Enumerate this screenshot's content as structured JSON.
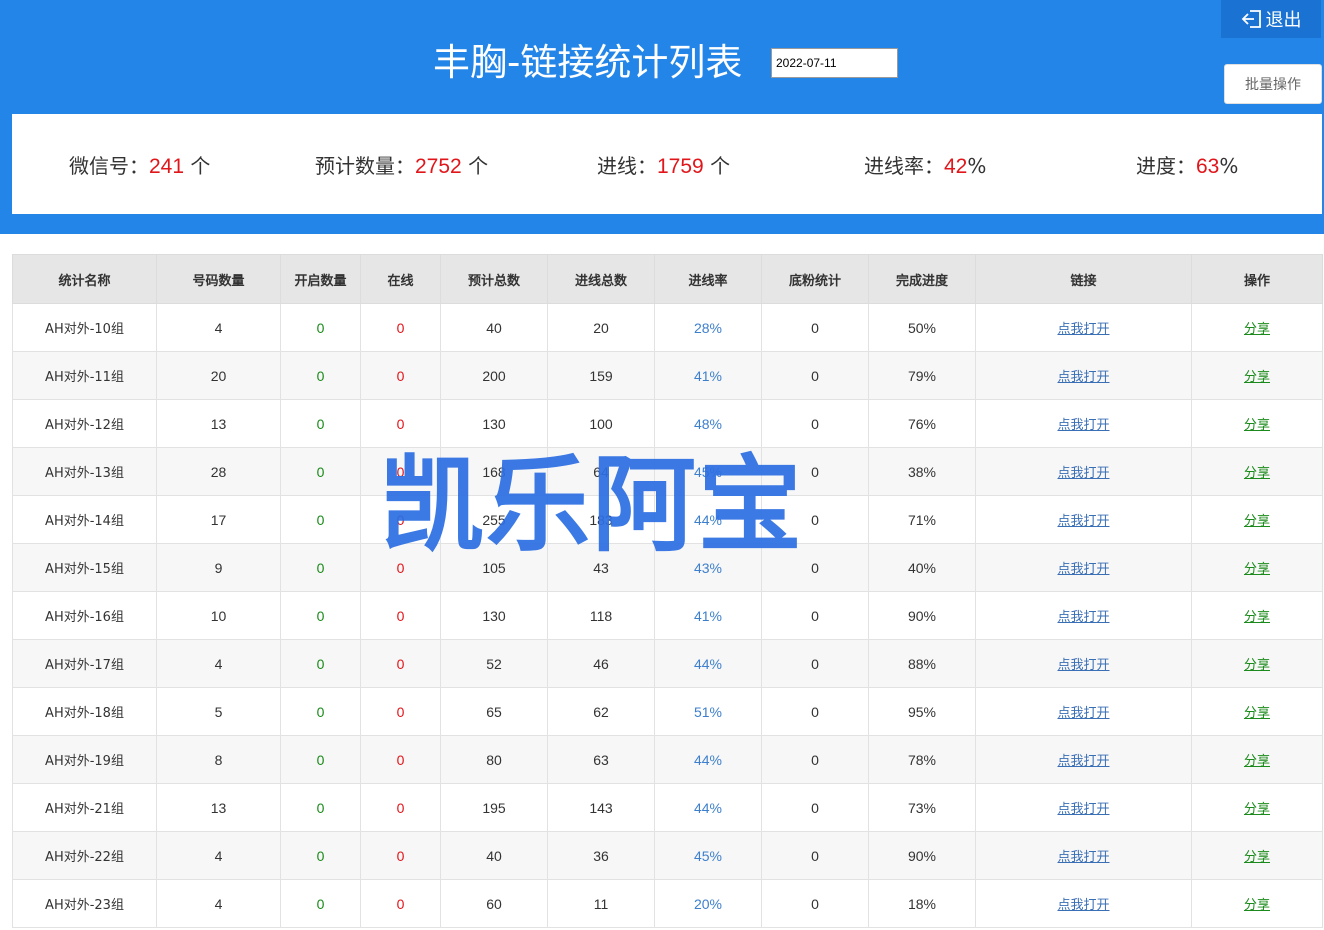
{
  "header": {
    "title": "丰胸-链接统计列表",
    "date_value": "2022-07-11",
    "logout_label": "退出",
    "batch_label": "批量操作"
  },
  "stats": {
    "wechat": {
      "label": "微信号：",
      "value": "241",
      "unit": " 个"
    },
    "expected": {
      "label": "预计数量：",
      "value": "2752",
      "unit": " 个"
    },
    "incoming": {
      "label": "进线：",
      "value": "1759",
      "unit": " 个"
    },
    "rate": {
      "label": "进线率：",
      "value": "42",
      "unit": "%"
    },
    "progress": {
      "label": "进度：",
      "value": "63",
      "unit": "%"
    }
  },
  "table": {
    "columns": [
      "统计名称",
      "号码数量",
      "开启数量",
      "在线",
      "预计总数",
      "进线总数",
      "进线率",
      "底粉统计",
      "完成进度",
      "链接",
      "操作"
    ],
    "link_label": "点我打开",
    "share_label": "分享",
    "rows": [
      {
        "name": "AH对外-10组",
        "numbers": "4",
        "enabled": "0",
        "online": "0",
        "expected": "40",
        "incoming": "20",
        "rate": "28%",
        "base": "0",
        "progress": "50%"
      },
      {
        "name": "AH对外-11组",
        "numbers": "20",
        "enabled": "0",
        "online": "0",
        "expected": "200",
        "incoming": "159",
        "rate": "41%",
        "base": "0",
        "progress": "79%"
      },
      {
        "name": "AH对外-12组",
        "numbers": "13",
        "enabled": "0",
        "online": "0",
        "expected": "130",
        "incoming": "100",
        "rate": "48%",
        "base": "0",
        "progress": "76%"
      },
      {
        "name": "AH对外-13组",
        "numbers": "28",
        "enabled": "0",
        "online": "0",
        "expected": "168",
        "incoming": "64",
        "rate": "45%",
        "base": "0",
        "progress": "38%"
      },
      {
        "name": "AH对外-14组",
        "numbers": "17",
        "enabled": "0",
        "online": "0",
        "expected": "255",
        "incoming": "183",
        "rate": "44%",
        "base": "0",
        "progress": "71%"
      },
      {
        "name": "AH对外-15组",
        "numbers": "9",
        "enabled": "0",
        "online": "0",
        "expected": "105",
        "incoming": "43",
        "rate": "43%",
        "base": "0",
        "progress": "40%"
      },
      {
        "name": "AH对外-16组",
        "numbers": "10",
        "enabled": "0",
        "online": "0",
        "expected": "130",
        "incoming": "118",
        "rate": "41%",
        "base": "0",
        "progress": "90%"
      },
      {
        "name": "AH对外-17组",
        "numbers": "4",
        "enabled": "0",
        "online": "0",
        "expected": "52",
        "incoming": "46",
        "rate": "44%",
        "base": "0",
        "progress": "88%"
      },
      {
        "name": "AH对外-18组",
        "numbers": "5",
        "enabled": "0",
        "online": "0",
        "expected": "65",
        "incoming": "62",
        "rate": "51%",
        "base": "0",
        "progress": "95%"
      },
      {
        "name": "AH对外-19组",
        "numbers": "8",
        "enabled": "0",
        "online": "0",
        "expected": "80",
        "incoming": "63",
        "rate": "44%",
        "base": "0",
        "progress": "78%"
      },
      {
        "name": "AH对外-21组",
        "numbers": "13",
        "enabled": "0",
        "online": "0",
        "expected": "195",
        "incoming": "143",
        "rate": "44%",
        "base": "0",
        "progress": "73%"
      },
      {
        "name": "AH对外-22组",
        "numbers": "4",
        "enabled": "0",
        "online": "0",
        "expected": "40",
        "incoming": "36",
        "rate": "45%",
        "base": "0",
        "progress": "90%"
      },
      {
        "name": "AH对外-23组",
        "numbers": "4",
        "enabled": "0",
        "online": "0",
        "expected": "60",
        "incoming": "11",
        "rate": "20%",
        "base": "0",
        "progress": "18%"
      }
    ]
  },
  "watermark": "凯乐阿宝",
  "colors": {
    "header_blue": "#2385e8",
    "stat_red": "#e0161b",
    "green": "#1a8a1a",
    "rate_blue": "#3d7fcc",
    "watermark_blue": "#2d6fe2"
  }
}
